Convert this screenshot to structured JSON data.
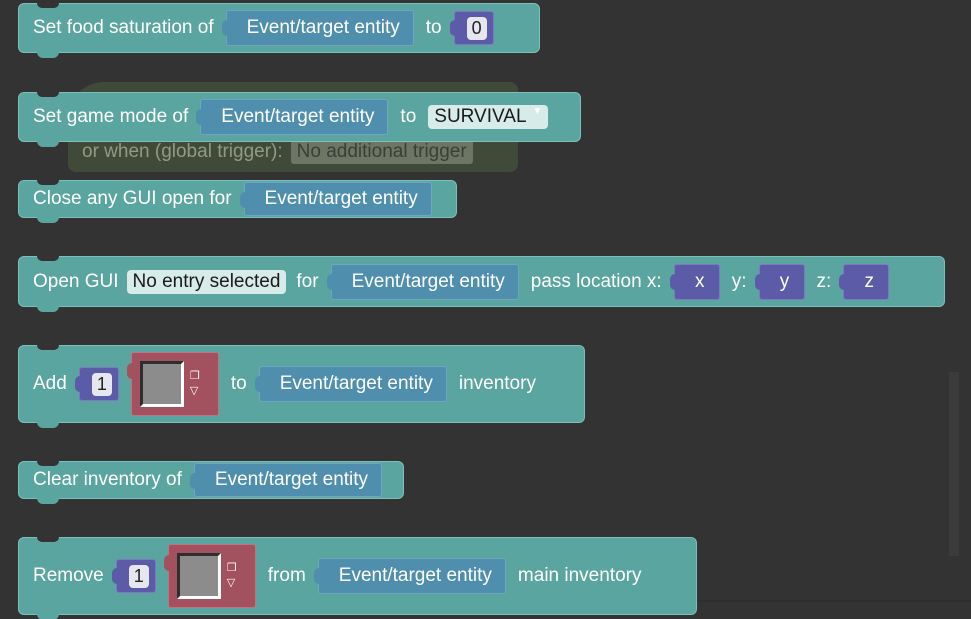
{
  "blocks": {
    "food": {
      "label": "Set food saturation of",
      "entity": "Event/target entity",
      "to": "to",
      "value": "0"
    },
    "gamemode": {
      "label": "Set game mode of",
      "entity": "Event/target entity",
      "to": "to",
      "mode": "SURVIVAL"
    },
    "ghost": {
      "label": "or when (global trigger):",
      "dropdown": "No additional trigger"
    },
    "closegui": {
      "label": "Close any GUI open for",
      "entity": "Event/target entity"
    },
    "opengui": {
      "label": "Open GUI",
      "gui": "No entry selected",
      "for": "for",
      "entity": "Event/target entity",
      "pass": "pass location x:",
      "x": "x",
      "ylabel": "y:",
      "y": "y",
      "zlabel": "z:",
      "z": "z"
    },
    "additem": {
      "label": "Add",
      "amount": "1",
      "to": "to",
      "entity": "Event/target entity",
      "suffix": "inventory"
    },
    "clearinv": {
      "label": "Clear inventory of",
      "entity": "Event/target entity"
    },
    "removeitem": {
      "label": "Remove",
      "amount": "1",
      "from": "from",
      "entity": "Event/target entity",
      "suffix": "main inventory"
    }
  },
  "icons": {
    "dropdown_arrow": "▼",
    "item_top": "❒",
    "item_bottom": "▽"
  },
  "colors": {
    "workspace": "#333333",
    "block": "#5aa59f",
    "entity_slot": "#4f8fad",
    "number_slot": "#5c5ba8",
    "item_slot": "#a3515e"
  }
}
